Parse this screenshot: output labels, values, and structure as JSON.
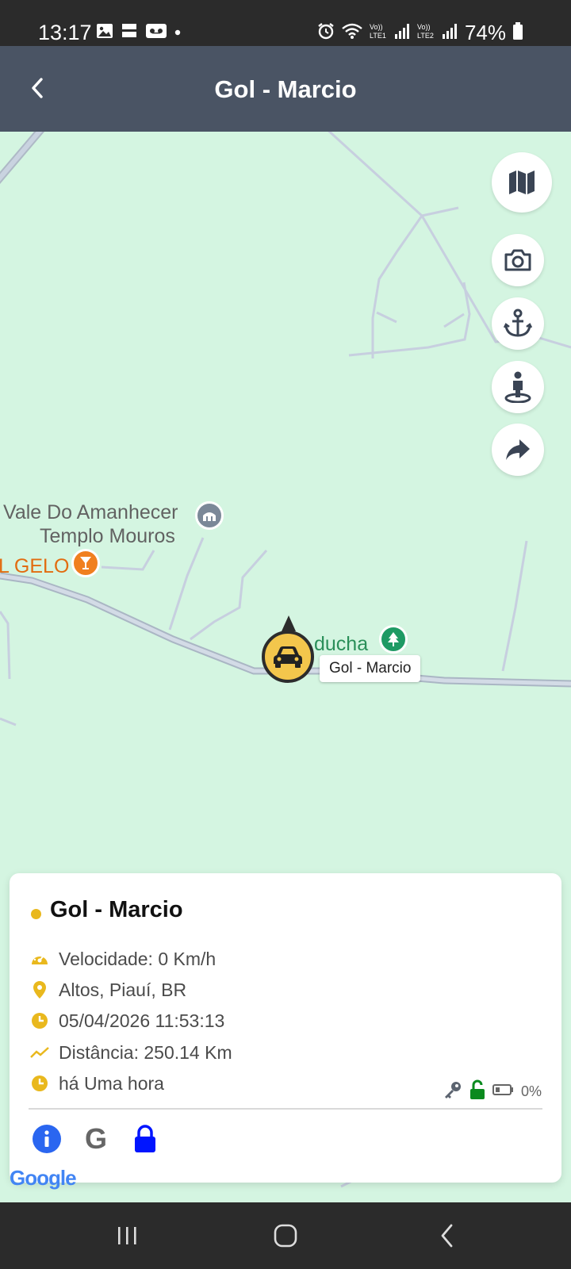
{
  "status_bar": {
    "time": "13:17",
    "battery_percent": "74%",
    "left_icons": [
      "gallery-icon",
      "tim-ads-icon",
      "voicemail-icon",
      "dot-icon"
    ],
    "right_icons": [
      "alarm-icon",
      "wifi-icon",
      "lte1-signal-icon",
      "lte2-signal-icon",
      "battery-icon"
    ]
  },
  "header": {
    "title": "Gol - Marcio"
  },
  "map": {
    "labels": {
      "vale_line1": "Vale Do Amanhecer",
      "vale_line2": "Templo Mouros",
      "gelo": "L GELO",
      "partial": "ducha"
    },
    "vehicle_tooltip": "Gol - Marcio",
    "attribution": "Google",
    "colors": {
      "land": "#d4f5e1",
      "road": "#c9d3e0",
      "marker": "#f3c64c",
      "poi_gray": "#7b8898",
      "poi_orange": "#f07f1f",
      "poi_green": "#1e9a64"
    }
  },
  "map_buttons": [
    "map-type-icon",
    "camera-icon",
    "anchor-icon",
    "street-view-icon",
    "share-icon"
  ],
  "card": {
    "title": "Gol - Marcio",
    "status_color": "#e9b81d",
    "speed": "Velocidade: 0 Km/h",
    "location": "Altos, Piauí, BR",
    "datetime": "05/04/2026 11:53:13",
    "distance": "Distância: 250.14 Km",
    "last_update": "há Uma hora",
    "battery": "0%",
    "ignition_icon": "key-icon",
    "lock_state_icon": "unlocked-icon",
    "actions": [
      "info-icon",
      "google-icon",
      "lock-icon"
    ]
  },
  "nav_bar": {
    "buttons": [
      "recents-icon",
      "home-icon",
      "back-icon"
    ]
  }
}
